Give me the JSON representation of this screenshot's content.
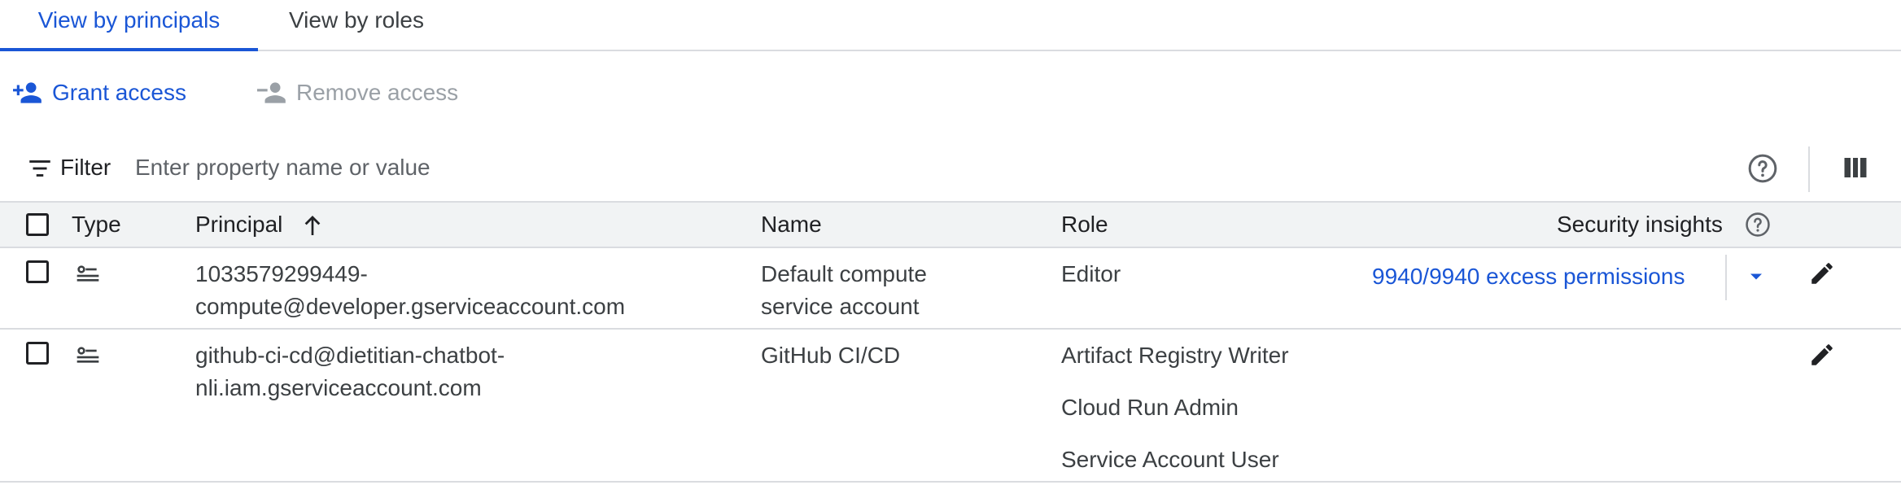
{
  "tabs": [
    {
      "label": "View by principals",
      "active": true
    },
    {
      "label": "View by roles",
      "active": false
    }
  ],
  "actions": {
    "grant_label": "Grant access",
    "remove_label": "Remove access"
  },
  "filter": {
    "label": "Filter",
    "placeholder": "Enter property name or value"
  },
  "table": {
    "columns": {
      "type": "Type",
      "principal": "Principal",
      "name": "Name",
      "role": "Role",
      "security_insights": "Security insights"
    },
    "rows": [
      {
        "principal_line1": "1033579299449-",
        "principal_line2": "compute@developer.gserviceaccount.com",
        "name_line1": "Default compute",
        "name_line2": "service account",
        "roles": [
          "Editor"
        ],
        "security_insight": "9940/9940 excess permissions"
      },
      {
        "principal_line1": "github-ci-cd@dietitian-chatbot-",
        "principal_line2": "nli.iam.gserviceaccount.com",
        "name_line1": "GitHub CI/CD",
        "name_line2": "",
        "roles": [
          "Artifact Registry Writer",
          "Cloud Run Admin",
          "Service Account User"
        ],
        "security_insight": ""
      }
    ]
  },
  "colors": {
    "accent": "#1a56d6",
    "disabled": "#9aa0a6",
    "header_bg": "#f1f3f4",
    "divider": "#dadce0"
  }
}
